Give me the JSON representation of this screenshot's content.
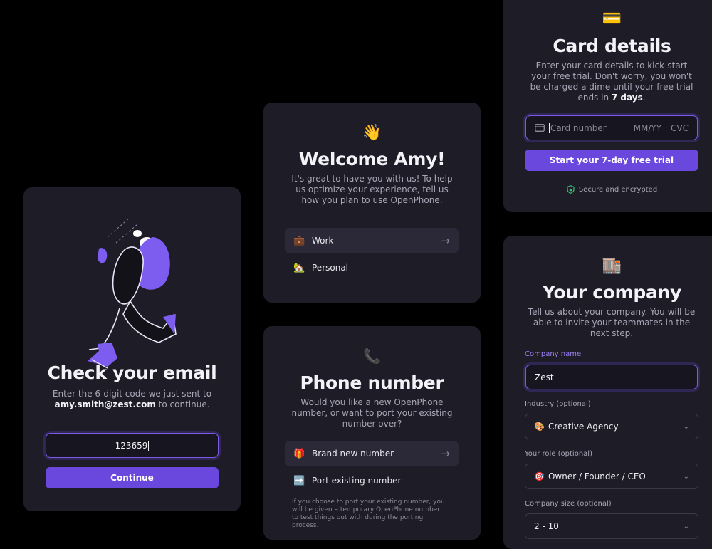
{
  "email_card": {
    "title": "Check your email",
    "desc_prefix": "Enter the 6-digit code we just sent to",
    "email": "amy.smith@zest.com",
    "desc_suffix": "to continue.",
    "code_value": "123659",
    "continue_label": "Continue"
  },
  "welcome_card": {
    "emoji": "👋",
    "title": "Welcome Amy!",
    "description": "It's great to have you with us! To help us optimize your experience, tell us how you plan to use OpenPhone.",
    "options": [
      {
        "icon": "💼",
        "label": "Work",
        "arrow": "→"
      },
      {
        "icon": "🏡",
        "label": "Personal"
      }
    ]
  },
  "phone_card": {
    "emoji": "📞",
    "title": "Phone number",
    "description": "Would you like a new OpenPhone number, or want to port your existing number over?",
    "options": [
      {
        "icon": "🎁",
        "label": "Brand new number",
        "arrow": "→"
      },
      {
        "icon": "➡️",
        "label": "Port existing number"
      }
    ],
    "footnote": "If you choose to port your existing number, you will be given a temporary OpenPhone number to test things out with during the porting process."
  },
  "card_details": {
    "emoji": "💳",
    "title": "Card details",
    "desc_main": "Enter your card details to kick-start your free trial. Don't worry, you won't be charged a dime until your free trial ends in",
    "desc_bold": "7 days",
    "desc_end": ".",
    "card_number_placeholder": "Card number",
    "expiry_placeholder": "MM/YY",
    "cvc_placeholder": "CVC",
    "trial_button_label": "Start your 7-day free trial",
    "secure_text": "Secure and encrypted"
  },
  "company_card": {
    "emoji": "🏬",
    "title": "Your company",
    "description": "Tell us about your company. You will be able to invite your teammates in the next step.",
    "company_name_label": "Company name",
    "company_name_value": "Zest",
    "industry_label": "Industry (optional)",
    "industry_icon": "🎨",
    "industry_value": "Creative Agency",
    "role_label": "Your role (optional)",
    "role_icon": "🎯",
    "role_value": "Owner / Founder / CEO",
    "size_label": "Company size (optional)",
    "size_value": "2 - 10"
  },
  "colors": {
    "background": "#000000",
    "card": "#1e1c27",
    "accent": "#6b48dd",
    "secure_icon": "#36c172"
  }
}
